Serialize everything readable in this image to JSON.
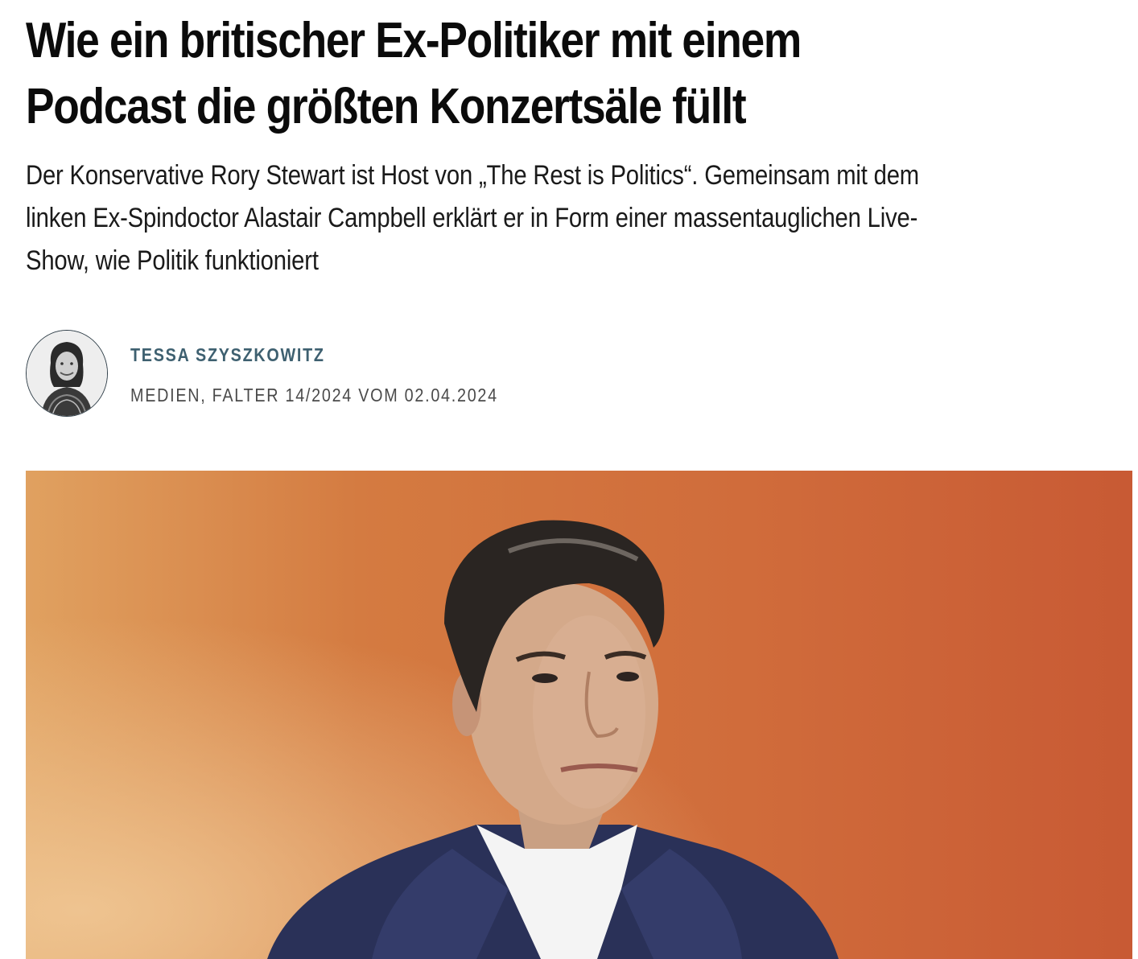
{
  "article": {
    "headline_line1": "Wie ein britischer Ex-Politiker mit einem",
    "headline_line2": "Podcast die größten Konzertsäle füllt",
    "lead_line1": "Der Konservative Rory Stewart ist Host von „The Rest is Politics“. Gemeinsam mit dem",
    "lead_line2": "linken Ex-Spindoctor Alastair Campbell erklärt er in Form einer massentauglichen Live-",
    "lead_line3": "Show, wie Politik funktioniert"
  },
  "byline": {
    "author": "TESSA SZYSZKOWITZ",
    "meta": "MEDIEN, FALTER 14/2024 VOM 02.04.2024"
  },
  "colors": {
    "author": "#3e6070",
    "hero_background": "#cf6a3a"
  }
}
